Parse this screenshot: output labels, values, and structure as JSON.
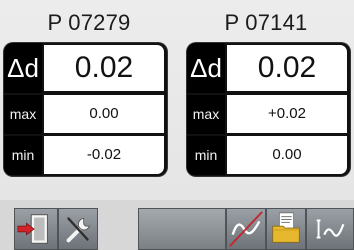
{
  "probes": [
    {
      "title": "P 07279",
      "delta_label": "Δd",
      "delta_value": "0.02",
      "max_label": "max",
      "max_value": "0.00",
      "min_label": "min",
      "min_value": "-0.02"
    },
    {
      "title": "P 07141",
      "delta_label": "Δd",
      "delta_value": "0.02",
      "max_label": "max",
      "max_value": "+0.02",
      "min_label": "min",
      "min_value": "0.00"
    }
  ],
  "toolbar": {
    "exit_icon": "exit-door-icon",
    "tools_icon": "wrench-icon",
    "wave_icon": "waveform-disabled-icon",
    "save_icon": "save-folder-icon",
    "trend_icon": "trend-icon"
  },
  "colors": {
    "card_background": "#111111",
    "value_background": "#ffffff",
    "toolbar_button": "#7c8287",
    "exit_arrow": "#d2232a",
    "strike": "#c1272d"
  }
}
